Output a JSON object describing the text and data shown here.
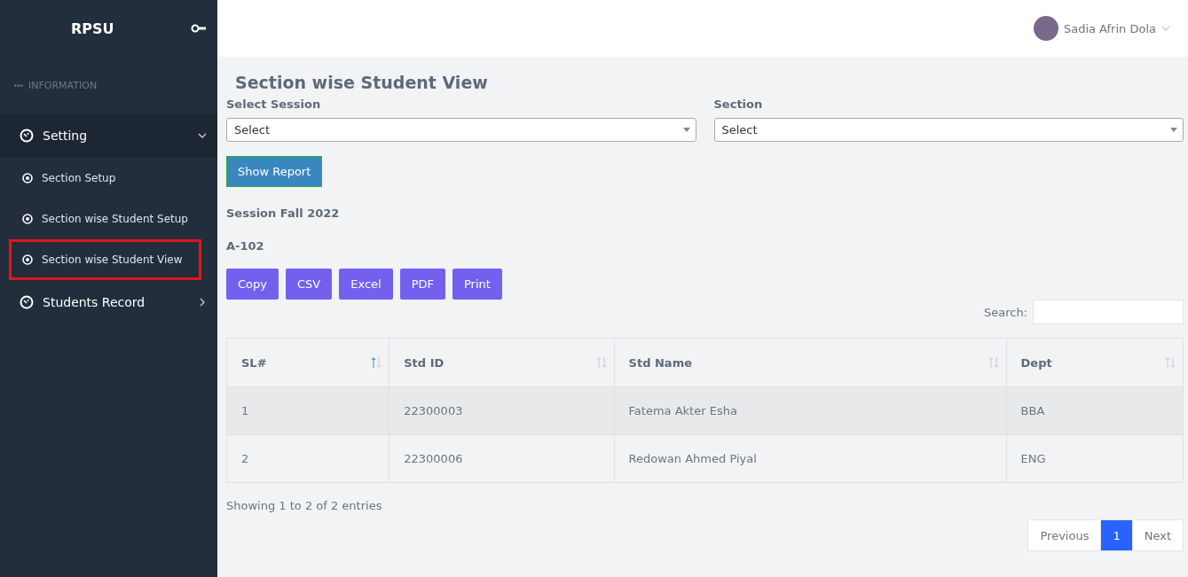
{
  "sidebar": {
    "brand": "RPSU",
    "section_label": "INFORMATION",
    "menu": [
      {
        "label": "Setting",
        "expanded": true,
        "children": [
          {
            "label": "Section Setup",
            "selected": false
          },
          {
            "label": "Section wise Student Setup",
            "selected": false
          },
          {
            "label": "Section wise Student View",
            "selected": true
          }
        ]
      },
      {
        "label": "Students Record",
        "expanded": false
      }
    ]
  },
  "header": {
    "user_name": "Sadia Afrin Dola"
  },
  "page_title": "Section wise Student View",
  "filters": [
    {
      "label": "Select Session",
      "value": "Select"
    },
    {
      "label": "Section",
      "value": "Select"
    }
  ],
  "show_report_button": "Show Report",
  "session_heading": "Session Fall 2022",
  "section_heading": "A-102",
  "export_buttons": [
    "Copy",
    "CSV",
    "Excel",
    "PDF",
    "Print"
  ],
  "search_label": "Search:",
  "table": {
    "columns": [
      {
        "label": "SL#",
        "sorted": true
      },
      {
        "label": "Std ID",
        "sorted": false
      },
      {
        "label": "Std Name",
        "sorted": false
      },
      {
        "label": "Dept",
        "sorted": false
      }
    ],
    "rows": [
      [
        "1",
        "22300003",
        "Fatema Akter Esha",
        "BBA"
      ],
      [
        "2",
        "22300006",
        "Redowan Ahmed Piyal",
        "ENG"
      ]
    ]
  },
  "entries_info": "Showing 1 to 2 of 2 entries",
  "pagination": [
    {
      "label": "Previous",
      "selected": false
    },
    {
      "label": "1",
      "selected": true
    },
    {
      "label": "Next",
      "selected": false
    }
  ]
}
